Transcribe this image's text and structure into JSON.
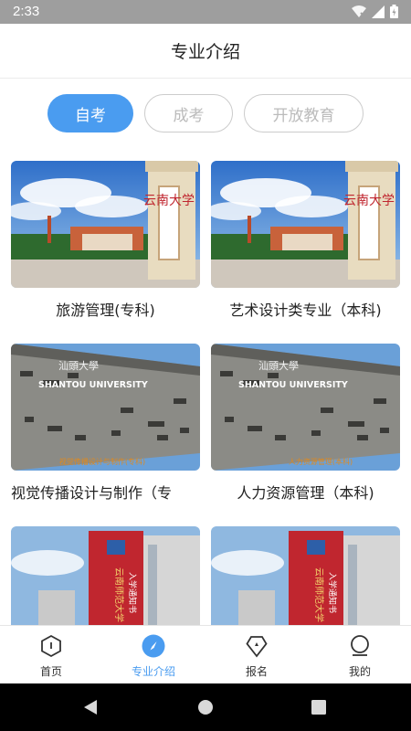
{
  "status_bar": {
    "time": "2:33"
  },
  "header": {
    "title": "专业介绍"
  },
  "tabs": [
    {
      "label": "自考",
      "active": true
    },
    {
      "label": "成考",
      "active": false
    },
    {
      "label": "开放教育",
      "active": false
    }
  ],
  "majors": [
    {
      "title": "旅游管理(专科)"
    },
    {
      "title": "艺术设计类专业（本科)"
    },
    {
      "title": "视觉传播设计与制作（专"
    },
    {
      "title": "人力资源管理（本科)"
    }
  ],
  "image_text": {
    "yunnan_sign": "云南大学",
    "shantou_cn": "汕頭大學",
    "shantou_en": "SHANTOU UNIVERSITY",
    "overlay_3": "视觉传播设计与制作(专科)",
    "overlay_4": "人力资源管理(本科)",
    "banner_a": "云南师范大学",
    "banner_b": "入学通知书"
  },
  "bottom_nav": [
    {
      "label": "首页",
      "icon": "home-hexagon-icon",
      "active": false
    },
    {
      "label": "专业介绍",
      "icon": "compass-icon",
      "active": true
    },
    {
      "label": "报名",
      "icon": "signup-pentagon-icon",
      "active": false
    },
    {
      "label": "我的",
      "icon": "profile-icon",
      "active": false
    }
  ],
  "colors": {
    "accent": "#4a9cf0",
    "status_bar": "#9e9e9e",
    "system_nav": "#000000"
  }
}
